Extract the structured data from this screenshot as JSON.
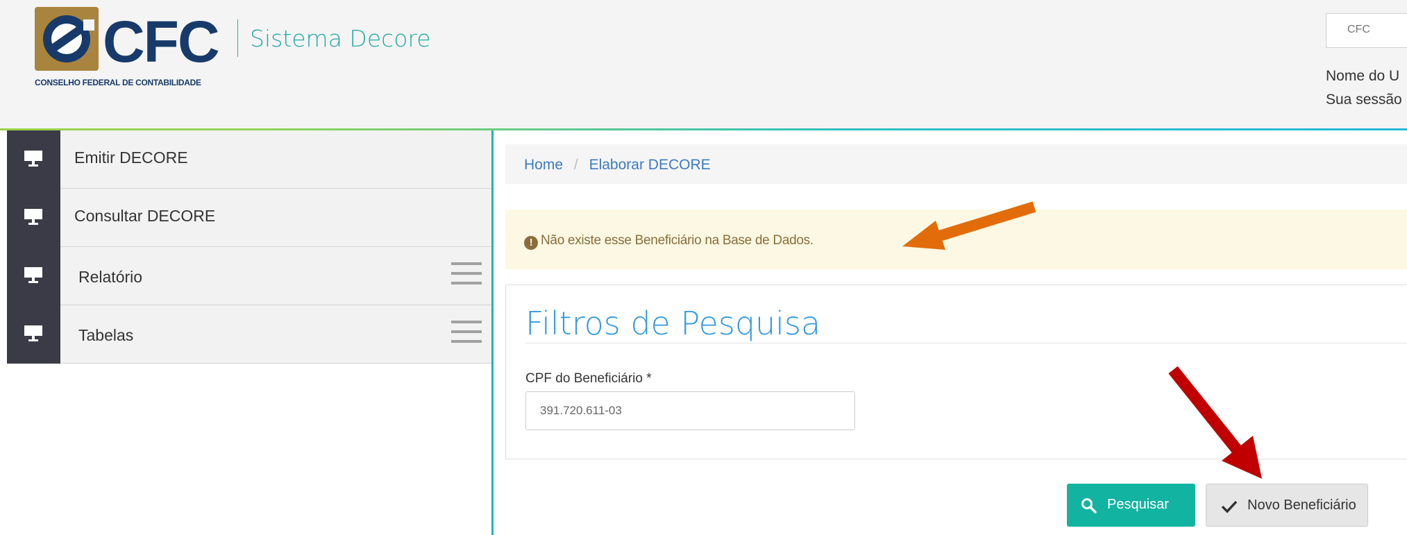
{
  "header": {
    "logo_text": "CFC",
    "logo_subtitle": "CONSELHO FEDERAL DE CONTABILIDADE",
    "system_name": "Sistema Decore",
    "org_select_value": "CFC",
    "user_line": "Nome do U",
    "session_line": "Sua sessão"
  },
  "sidebar": {
    "items": [
      {
        "label": "Emitir DECORE",
        "icon": "monitor-icon"
      },
      {
        "label": "Consultar DECORE",
        "icon": "monitor-icon"
      },
      {
        "label": "Relatório",
        "icon": "monitor-icon",
        "has_menu": true
      },
      {
        "label": "Tabelas",
        "icon": "monitor-icon",
        "has_menu": true
      }
    ]
  },
  "breadcrumb": {
    "home": "Home",
    "separator": "/",
    "current": "Elaborar DECORE"
  },
  "alert": {
    "icon": "!",
    "message": "Não existe esse Beneficiário na Base de Dados."
  },
  "panel": {
    "title": "Filtros de Pesquisa",
    "cpf_label": "CPF do Beneficiário *",
    "cpf_value": "391.720.611-03"
  },
  "buttons": {
    "search_label": "Pesquisar",
    "new_label": "Novo Beneficiário"
  },
  "colors": {
    "accent": "#12b3a1",
    "title_blue": "#3399dd",
    "sidebar_icon_bg": "#3b3b47",
    "alert_bg": "#fcf8e3",
    "brand_navy": "#173a6b",
    "brand_gold": "#a8843e",
    "annotation_orange": "#e36c0a",
    "annotation_red": "#c00000"
  }
}
